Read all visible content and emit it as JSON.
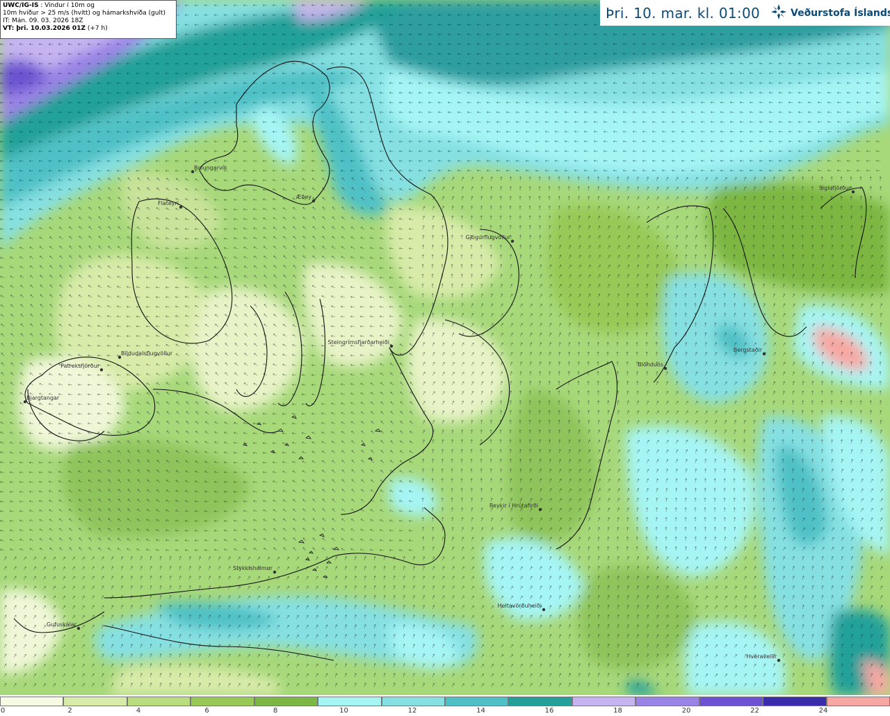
{
  "info_box": {
    "product": "UWC/IG-IS",
    "title_rest": " : Vindur í 10m og",
    "line2": "10m hviður > 25 m/s (hvítt) og hámarkshviða (gult)",
    "line3": "IT: Mán. 09. 03. 2026 18Z",
    "vt_label": "VT: þri. 10.03.2026 01Z",
    "vt_lead": " (+7 h)"
  },
  "header": {
    "valid_time": "Þri. 10. mar. kl. 01:00",
    "brand": "Veðurstofa Íslands",
    "brand_icon": "snowflake-logo-icon"
  },
  "places": [
    {
      "name": "Bolungarvík"
    },
    {
      "name": "Flateyri"
    },
    {
      "name": "Æðey"
    },
    {
      "name": "Gjögurflugvöllur"
    },
    {
      "name": "Siglufjörður"
    },
    {
      "name": "Patreksfjörður"
    },
    {
      "name": "Bíldudalsflugvöllur"
    },
    {
      "name": "Bjargtangar"
    },
    {
      "name": "Steingrímsfjarðarheiði"
    },
    {
      "name": "Blönduós"
    },
    {
      "name": "Bergstaðir"
    },
    {
      "name": "Reykir í Hrútafirði"
    },
    {
      "name": "Stykkishólmur"
    },
    {
      "name": "Holtavörðuheiði"
    },
    {
      "name": "Gufuskálar"
    },
    {
      "name": "Hveravellir"
    }
  ],
  "colorbar": {
    "unit": "m/s",
    "ticks": [
      "0",
      "2",
      "4",
      "6",
      "8",
      "10",
      "12",
      "14",
      "16",
      "18",
      "20",
      "22",
      "24"
    ],
    "colors": [
      "#f7fbe3",
      "#d8eba9",
      "#b9dc7f",
      "#98c957",
      "#7db743",
      "#a6f5f5",
      "#86e0e2",
      "#4fc1c6",
      "#23a09a",
      "#c5b4f0",
      "#9a83e6",
      "#6c52d2",
      "#3b2cab",
      "#f7a7a3"
    ]
  }
}
